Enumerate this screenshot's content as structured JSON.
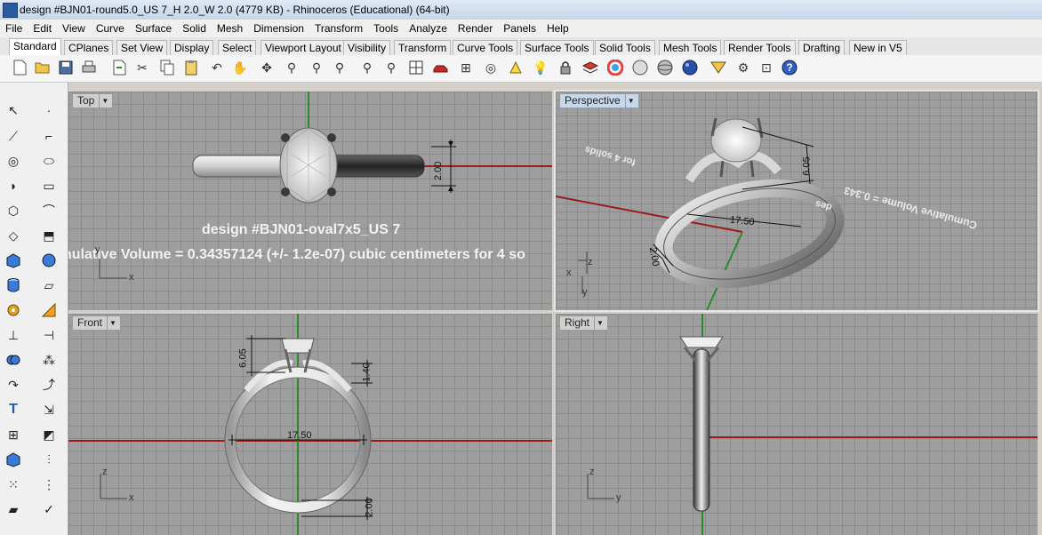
{
  "window": {
    "title": "design #BJN01-round5.0_US 7_H 2.0_W 2.0 (4779 KB) - Rhinoceros (Educational) (64-bit)"
  },
  "menu": [
    "File",
    "Edit",
    "View",
    "Curve",
    "Surface",
    "Solid",
    "Mesh",
    "Dimension",
    "Transform",
    "Tools",
    "Analyze",
    "Render",
    "Panels",
    "Help"
  ],
  "tabs": [
    "Standard",
    "CPlanes",
    "Set View",
    "Display",
    "Select",
    "Viewport Layout",
    "Visibility",
    "Transform",
    "Curve Tools",
    "Surface Tools",
    "Solid Tools",
    "Mesh Tools",
    "Render Tools",
    "Drafting",
    "New in V5"
  ],
  "active_tab": "Standard",
  "toolbar_icons": [
    "new-icon",
    "open-icon",
    "save-icon",
    "print-icon",
    "import-icon",
    "cut-icon",
    "copy-icon",
    "paste-icon",
    "undo-icon",
    "pan-icon",
    "rotate-view-icon",
    "zoom-dynamic-icon",
    "zoom-window-icon",
    "zoom-extents-icon",
    "zoom-selected-icon",
    "four-views-icon",
    "car-icon",
    "select-filter-icon",
    "object-snap-icon",
    "point-icon",
    "light-icon",
    "lock-icon",
    "layer-icon",
    "color-icon",
    "wireframe-icon",
    "shaded-icon",
    "render-icon",
    "gumball-icon",
    "options-icon",
    "help-icon"
  ],
  "viewports": {
    "top": {
      "label": "Top",
      "title_line": "design #BJN01-oval7x5_US 7",
      "volume_line": "nulative Volume = 0.34357124 (+/- 1.2e-07) cubic centimeters for 4 so",
      "dim_height": "2.00",
      "axis_y": "y",
      "axis_x": "x"
    },
    "perspective": {
      "label": "Perspective",
      "dim_stone": "6.05",
      "dim_diameter": "17.50",
      "dim_band": "2.00",
      "mirrored_1": "Cumulative Volume = 0.343",
      "mirrored_2": "for 4 solids",
      "mirrored_3": "des",
      "axis_z": "z",
      "axis_y": "y",
      "axis_x": "x"
    },
    "front": {
      "label": "Front",
      "dim_stone": "6.05",
      "dim_side": "1.40",
      "dim_diameter": "17.50",
      "dim_band": "2.00",
      "axis_z": "z",
      "axis_x": "x"
    },
    "right": {
      "label": "Right",
      "axis_z": "z",
      "axis_y": "y"
    }
  },
  "colors": {
    "viewport_bg": "#9e9e9e",
    "grid_line": "#8b8b8b",
    "x_axis": "#9b1a1a",
    "y_axis": "#2a8a2a",
    "active_label": "#c8d8ec"
  }
}
